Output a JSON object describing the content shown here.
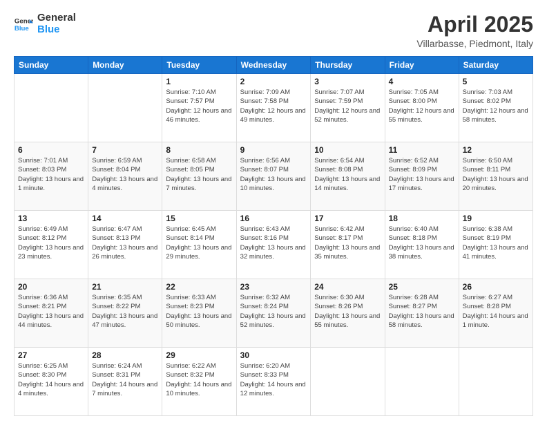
{
  "header": {
    "logo": {
      "line1": "General",
      "line2": "Blue"
    },
    "title": "April 2025",
    "location": "Villarbasse, Piedmont, Italy"
  },
  "weekdays": [
    "Sunday",
    "Monday",
    "Tuesday",
    "Wednesday",
    "Thursday",
    "Friday",
    "Saturday"
  ],
  "weeks": [
    [
      {
        "day": "",
        "info": ""
      },
      {
        "day": "",
        "info": ""
      },
      {
        "day": "1",
        "info": "Sunrise: 7:10 AM\nSunset: 7:57 PM\nDaylight: 12 hours and 46 minutes."
      },
      {
        "day": "2",
        "info": "Sunrise: 7:09 AM\nSunset: 7:58 PM\nDaylight: 12 hours and 49 minutes."
      },
      {
        "day": "3",
        "info": "Sunrise: 7:07 AM\nSunset: 7:59 PM\nDaylight: 12 hours and 52 minutes."
      },
      {
        "day": "4",
        "info": "Sunrise: 7:05 AM\nSunset: 8:00 PM\nDaylight: 12 hours and 55 minutes."
      },
      {
        "day": "5",
        "info": "Sunrise: 7:03 AM\nSunset: 8:02 PM\nDaylight: 12 hours and 58 minutes."
      }
    ],
    [
      {
        "day": "6",
        "info": "Sunrise: 7:01 AM\nSunset: 8:03 PM\nDaylight: 13 hours and 1 minute."
      },
      {
        "day": "7",
        "info": "Sunrise: 6:59 AM\nSunset: 8:04 PM\nDaylight: 13 hours and 4 minutes."
      },
      {
        "day": "8",
        "info": "Sunrise: 6:58 AM\nSunset: 8:05 PM\nDaylight: 13 hours and 7 minutes."
      },
      {
        "day": "9",
        "info": "Sunrise: 6:56 AM\nSunset: 8:07 PM\nDaylight: 13 hours and 10 minutes."
      },
      {
        "day": "10",
        "info": "Sunrise: 6:54 AM\nSunset: 8:08 PM\nDaylight: 13 hours and 14 minutes."
      },
      {
        "day": "11",
        "info": "Sunrise: 6:52 AM\nSunset: 8:09 PM\nDaylight: 13 hours and 17 minutes."
      },
      {
        "day": "12",
        "info": "Sunrise: 6:50 AM\nSunset: 8:11 PM\nDaylight: 13 hours and 20 minutes."
      }
    ],
    [
      {
        "day": "13",
        "info": "Sunrise: 6:49 AM\nSunset: 8:12 PM\nDaylight: 13 hours and 23 minutes."
      },
      {
        "day": "14",
        "info": "Sunrise: 6:47 AM\nSunset: 8:13 PM\nDaylight: 13 hours and 26 minutes."
      },
      {
        "day": "15",
        "info": "Sunrise: 6:45 AM\nSunset: 8:14 PM\nDaylight: 13 hours and 29 minutes."
      },
      {
        "day": "16",
        "info": "Sunrise: 6:43 AM\nSunset: 8:16 PM\nDaylight: 13 hours and 32 minutes."
      },
      {
        "day": "17",
        "info": "Sunrise: 6:42 AM\nSunset: 8:17 PM\nDaylight: 13 hours and 35 minutes."
      },
      {
        "day": "18",
        "info": "Sunrise: 6:40 AM\nSunset: 8:18 PM\nDaylight: 13 hours and 38 minutes."
      },
      {
        "day": "19",
        "info": "Sunrise: 6:38 AM\nSunset: 8:19 PM\nDaylight: 13 hours and 41 minutes."
      }
    ],
    [
      {
        "day": "20",
        "info": "Sunrise: 6:36 AM\nSunset: 8:21 PM\nDaylight: 13 hours and 44 minutes."
      },
      {
        "day": "21",
        "info": "Sunrise: 6:35 AM\nSunset: 8:22 PM\nDaylight: 13 hours and 47 minutes."
      },
      {
        "day": "22",
        "info": "Sunrise: 6:33 AM\nSunset: 8:23 PM\nDaylight: 13 hours and 50 minutes."
      },
      {
        "day": "23",
        "info": "Sunrise: 6:32 AM\nSunset: 8:24 PM\nDaylight: 13 hours and 52 minutes."
      },
      {
        "day": "24",
        "info": "Sunrise: 6:30 AM\nSunset: 8:26 PM\nDaylight: 13 hours and 55 minutes."
      },
      {
        "day": "25",
        "info": "Sunrise: 6:28 AM\nSunset: 8:27 PM\nDaylight: 13 hours and 58 minutes."
      },
      {
        "day": "26",
        "info": "Sunrise: 6:27 AM\nSunset: 8:28 PM\nDaylight: 14 hours and 1 minute."
      }
    ],
    [
      {
        "day": "27",
        "info": "Sunrise: 6:25 AM\nSunset: 8:30 PM\nDaylight: 14 hours and 4 minutes."
      },
      {
        "day": "28",
        "info": "Sunrise: 6:24 AM\nSunset: 8:31 PM\nDaylight: 14 hours and 7 minutes."
      },
      {
        "day": "29",
        "info": "Sunrise: 6:22 AM\nSunset: 8:32 PM\nDaylight: 14 hours and 10 minutes."
      },
      {
        "day": "30",
        "info": "Sunrise: 6:20 AM\nSunset: 8:33 PM\nDaylight: 14 hours and 12 minutes."
      },
      {
        "day": "",
        "info": ""
      },
      {
        "day": "",
        "info": ""
      },
      {
        "day": "",
        "info": ""
      }
    ]
  ]
}
